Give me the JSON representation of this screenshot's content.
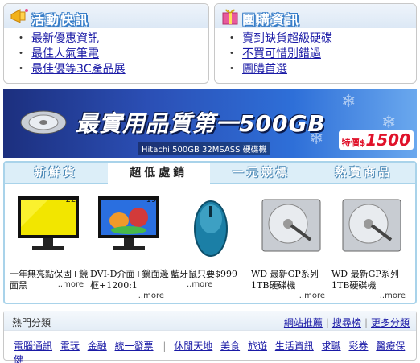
{
  "news_box": {
    "title": "活動快訊",
    "items": [
      "最新優惠資訊",
      "最佳人氣筆電",
      "最佳優等3C產品展"
    ]
  },
  "group_box": {
    "title": "團購資訊",
    "items": [
      "賣到缺貨超級硬碟",
      "不買可惜別錯過",
      "團購首選"
    ]
  },
  "banner": {
    "headline": "最實用品質第一500GB",
    "subline": "Hitachi 500GB 32MSASS 硬碟機",
    "price_label": "特價$",
    "price_value": "1500"
  },
  "tabs": [
    "新鮮貨",
    "超低處銷",
    "一元競標",
    "熱賣商品"
  ],
  "active_tab": 1,
  "products": [
    {
      "badge": "22",
      "caption": "一年無亮點保固+鏡面黑",
      "more": "..more"
    },
    {
      "badge": "19",
      "caption": "DVI-D介面+鏡面邊框+1200:1",
      "more": "..more"
    },
    {
      "badge": "",
      "caption": "藍牙鼠只要$999",
      "more": "..more"
    },
    {
      "badge": "",
      "caption": "WD 最新GP系列1TB硬碟機",
      "more": "..more"
    },
    {
      "badge": "",
      "caption": "WD 最新GP系列1TB硬碟機",
      "more": "..more"
    }
  ],
  "categories": {
    "label": "熱門分類",
    "links_right": [
      "網站推薦",
      "搜尋榜",
      "更多分類"
    ],
    "group_a": [
      "電腦通訊",
      "電玩",
      "金融",
      "統一發票"
    ],
    "group_b": [
      "休閒天地",
      "美食",
      "旅遊",
      "生活資訊",
      "求職",
      "彩券",
      "醫療保健"
    ]
  },
  "colors": {
    "link": "#1a1aa6",
    "tab_bg": "#dceef8",
    "panel_border": "#a9d3ea",
    "banner_blue": "#2b4fb5",
    "price_red": "#e0122a"
  },
  "icons": {
    "news": "megaphone-icon",
    "group": "gift-icon"
  }
}
